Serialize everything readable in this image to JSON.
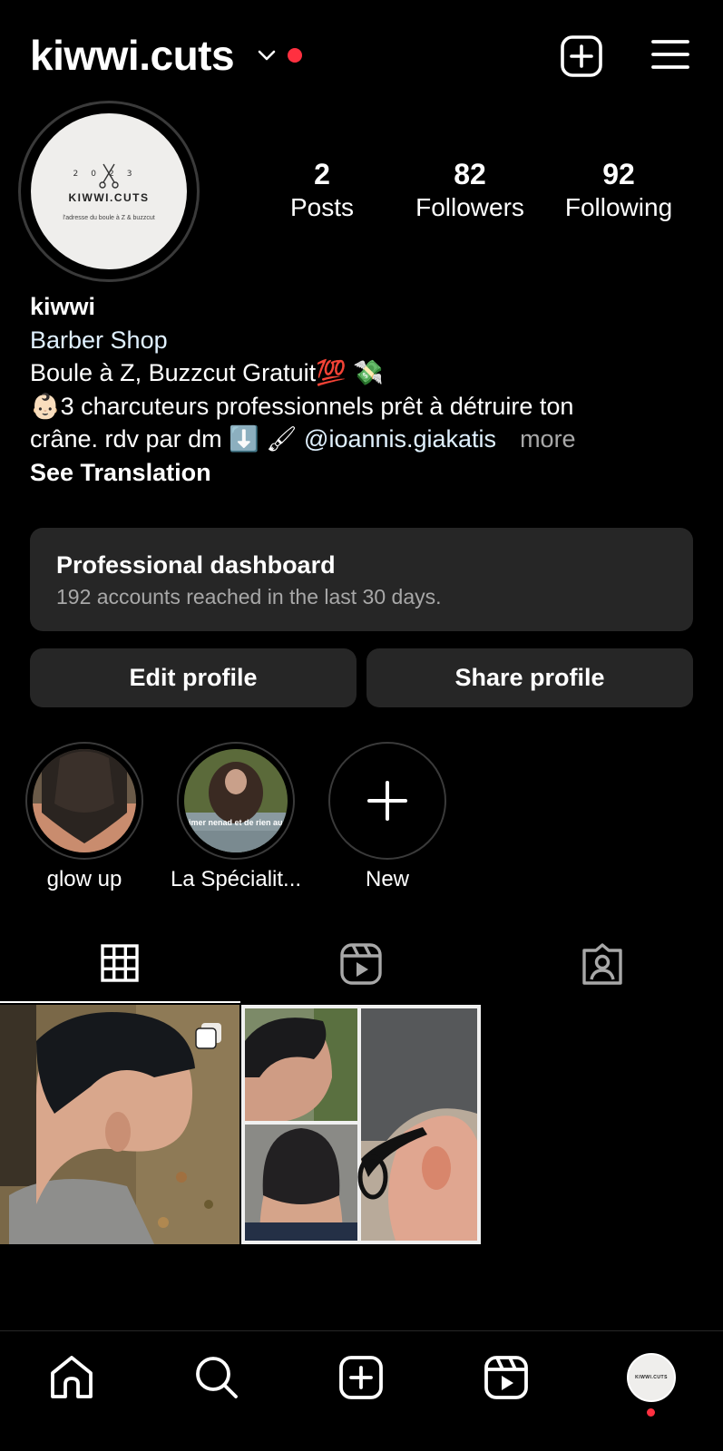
{
  "header": {
    "username": "kiwwi.cuts",
    "chevron_icon": "chevron-down-icon",
    "add_icon": "plus-square-icon",
    "menu_icon": "hamburger-menu-icon",
    "notification_color": "#ff3040"
  },
  "profile": {
    "avatar_logo": {
      "year": "2023",
      "name": "KIWWI.CUTS",
      "tagline": "l'adresse du boule à Z & buzzcut"
    },
    "stats": [
      {
        "num": "2",
        "label": "Posts"
      },
      {
        "num": "82",
        "label": "Followers"
      },
      {
        "num": "92",
        "label": "Following"
      }
    ]
  },
  "bio": {
    "name": "kiwwi",
    "category": "Barber Shop",
    "line1": "Boule à Z, Buzzcut Gratuit",
    "line1_emoji": "💯 💸",
    "line2": "3 charcuteurs professionnels prêt à détruire ton",
    "line2_emoji": "👶🏻",
    "line3": "crâne. rdv par dm",
    "line3_emoji": "⬇️ 🖌",
    "mention": "@ioannis.giakatis",
    "more": "more",
    "see_translation": "See Translation",
    "accent": "#e0f1ff"
  },
  "dashboard": {
    "title": "Professional dashboard",
    "subtitle": "192 accounts reached in the last 30 days."
  },
  "buttons": {
    "edit": "Edit profile",
    "share": "Share profile"
  },
  "highlights": [
    {
      "label": "glow up"
    },
    {
      "label": "La Spécialit...",
      "overlay_text": "aimer nenad et de rien aussi"
    },
    {
      "label": "New"
    }
  ],
  "tabs": [
    {
      "icon": "grid-icon",
      "active": true
    },
    {
      "icon": "reels-icon",
      "active": false
    },
    {
      "icon": "tagged-icon",
      "active": false
    }
  ],
  "posts": [
    {
      "type": "carousel",
      "icon": "multiple-posts-icon"
    },
    {
      "type": "single"
    }
  ],
  "bottom_nav": [
    {
      "icon": "home-icon"
    },
    {
      "icon": "search-icon"
    },
    {
      "icon": "create-icon"
    },
    {
      "icon": "reels-icon"
    },
    {
      "icon": "profile-avatar"
    }
  ]
}
